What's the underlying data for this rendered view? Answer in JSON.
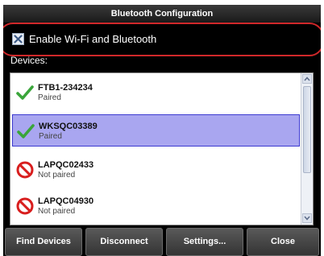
{
  "title": "Bluetooth Configuration",
  "enable_option": {
    "label": "Enable Wi-Fi and Bluetooth",
    "checked": true
  },
  "devices_label": "Devices:",
  "devices": [
    {
      "name": "FTB1-234234",
      "status": "Paired",
      "icon": "check-icon",
      "selected": false
    },
    {
      "name": "WKSQC03389",
      "status": "Paired",
      "icon": "check-icon",
      "selected": true
    },
    {
      "name": "LAPQC02433",
      "status": "Not paired",
      "icon": "prohibited-icon",
      "selected": false
    },
    {
      "name": "LAPQC04930",
      "status": "Not paired",
      "icon": "prohibited-icon",
      "selected": false
    }
  ],
  "buttons": {
    "find": "Find Devices",
    "disconnect": "Disconnect",
    "settings": "Settings...",
    "close": "Close"
  },
  "colors": {
    "selection": "#a9a6f0",
    "highlight_outline": "#d0282a",
    "paired_icon": "#3aa53a",
    "not_paired_icon": "#d81e1e"
  }
}
